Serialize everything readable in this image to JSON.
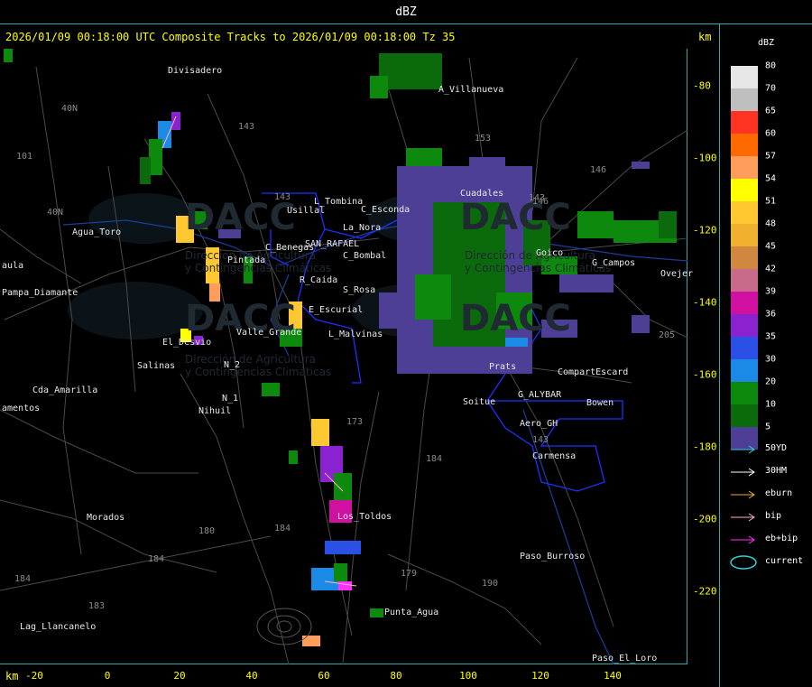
{
  "window": {
    "title": "dBZ"
  },
  "header": {
    "text": "2026/01/09 00:18:00 UTC Composite Tracks to 2026/01/09 00:18:00 Tz 35",
    "km_top": "km",
    "km_bottom": "km"
  },
  "axes": {
    "x_ticks": [
      "-20",
      "0",
      "20",
      "40",
      "60",
      "80",
      "100",
      "120",
      "140"
    ],
    "y_ticks": [
      "-80",
      "-100",
      "-120",
      "-140",
      "-160",
      "-180",
      "-200",
      "-220"
    ]
  },
  "legend": {
    "title": "dBZ",
    "scale": [
      {
        "label": "80",
        "color": "#e6e6e6"
      },
      {
        "label": "70",
        "color": "#bfbfbf"
      },
      {
        "label": "65",
        "color": "#ff3322"
      },
      {
        "label": "60",
        "color": "#ff6a00"
      },
      {
        "label": "57",
        "color": "#ff9e5a"
      },
      {
        "label": "54",
        "color": "#ffff00"
      },
      {
        "label": "51",
        "color": "#ffc830"
      },
      {
        "label": "48",
        "color": "#f0b030"
      },
      {
        "label": "45",
        "color": "#d08840"
      },
      {
        "label": "42",
        "color": "#c86a8a"
      },
      {
        "label": "39",
        "color": "#d010a0"
      },
      {
        "label": "36",
        "color": "#8a22d0"
      },
      {
        "label": "35",
        "color": "#2a50e6"
      },
      {
        "label": "30",
        "color": "#1a8ae6"
      },
      {
        "label": "20",
        "color": "#0d8a0d"
      },
      {
        "label": "10",
        "color": "#0b6a0b"
      },
      {
        "label": "5",
        "color": "#4d3f96"
      }
    ],
    "tracks": [
      {
        "label": "50YD",
        "color": "#30d0e0"
      },
      {
        "label": "30HM",
        "color": "#ffffff"
      },
      {
        "label": "eburn",
        "color": "#e8b030"
      },
      {
        "label": "bip",
        "color": "#ffb0c8"
      },
      {
        "label": "eb+bip",
        "color": "#ff30ff"
      },
      {
        "label": "current",
        "color": "#30d0e0"
      }
    ]
  },
  "places": [
    {
      "name": "Divisadero"
    },
    {
      "name": "A_Villanueva"
    },
    {
      "name": "Agua_Toro"
    },
    {
      "name": "aula"
    },
    {
      "name": "Pampa_Diamante"
    },
    {
      "name": "El_Desvio"
    },
    {
      "name": "Salinas"
    },
    {
      "name": "Cda_Amarilla"
    },
    {
      "name": "amentos"
    },
    {
      "name": "Morados"
    },
    {
      "name": "Lag_Llancanelo"
    },
    {
      "name": "Nihuil"
    },
    {
      "name": "N_1"
    },
    {
      "name": "N_2"
    },
    {
      "name": "Valle_Grande"
    },
    {
      "name": "E_Escurial"
    },
    {
      "name": "L_Malvinas"
    },
    {
      "name": "R_Caida"
    },
    {
      "name": "S_Rosa"
    },
    {
      "name": "Pintada"
    },
    {
      "name": "Usillal"
    },
    {
      "name": "L_Tombina"
    },
    {
      "name": "La_Nora"
    },
    {
      "name": "C_Bombal"
    },
    {
      "name": "C_Benegas"
    },
    {
      "name": "SAN_RAFAEL"
    },
    {
      "name": "Goico"
    },
    {
      "name": "G_Campos"
    },
    {
      "name": "Ovejer"
    },
    {
      "name": "Soitue"
    },
    {
      "name": "G_ALYBAR"
    },
    {
      "name": "Bowen"
    },
    {
      "name": "Aero_GH"
    },
    {
      "name": "Carmensa"
    },
    {
      "name": "CompartEscard"
    },
    {
      "name": "Prats"
    },
    {
      "name": "Paso_Burroso"
    },
    {
      "name": "Punta_Agua"
    },
    {
      "name": "Paso_El_Loro"
    },
    {
      "name": "Los_Toldos"
    },
    {
      "name": "Cuadales"
    },
    {
      "name": "C_Esconda"
    }
  ],
  "routes": [
    "40N",
    "40N",
    "101",
    "143",
    "143",
    "153",
    "146",
    "143",
    "173",
    "184",
    "184",
    "180",
    "184",
    "179",
    "190",
    "143",
    "183",
    "205",
    "184",
    "146"
  ],
  "watermark": {
    "text": "DACC",
    "line1": "Dirección de Agricultura",
    "line2": "y Contingencias Climáticas"
  }
}
